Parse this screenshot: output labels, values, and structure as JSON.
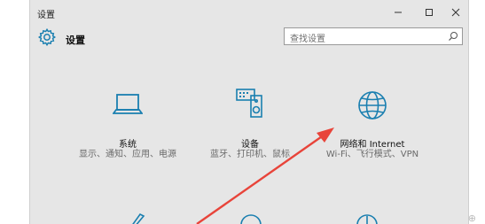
{
  "window": {
    "title": "设置"
  },
  "controls": {
    "minimize": "—",
    "maximize": "☐",
    "close": "✕"
  },
  "header": {
    "title": "设置"
  },
  "search": {
    "placeholder": "查找设置"
  },
  "tiles": [
    {
      "name": "系统",
      "description": "显示、通知、应用、电源",
      "icon": "laptop-icon"
    },
    {
      "name": "设备",
      "description": "蓝牙、打印机、鼠标",
      "icon": "devices-icon"
    },
    {
      "name": "网络和 Internet",
      "description": "Wi-Fi、飞行模式、VPN",
      "icon": "globe-icon"
    }
  ],
  "annotation": {
    "arrow_color": "#e8443a"
  },
  "accent_color": "#1a7fb0"
}
